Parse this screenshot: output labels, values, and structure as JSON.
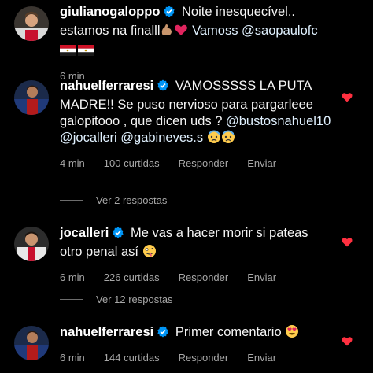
{
  "colors": {
    "background": "#000000",
    "text": "#f5f5f5",
    "meta": "#a8a8a8",
    "verified": "#0095f6",
    "heart": "#ff3040"
  },
  "comments": [
    {
      "username": "giulianogaloppo",
      "verified": true,
      "text": "Noite inesquecível.. estamos na finalll",
      "text_tail": "Vamoss @saopaulofc",
      "emojis": [
        "flexed-biceps-emoji",
        "red-heart-emoji",
        "egypt-flag-emoji",
        "egypt-flag-emoji"
      ],
      "time": "6 min",
      "likes": "",
      "reply": "",
      "send": "",
      "liked": false
    },
    {
      "username": "nahuelferraresi",
      "verified": true,
      "text": "VAMOSSSSS LA PUTA MADRE!! Se puso nervioso para pargarleee galopitooo , que dicen uds ? @bustosnahuel10 @jocalleri @gabineves.s",
      "emojis": [
        "anxious-face-emoji",
        "anxious-face-emoji"
      ],
      "time": "4 min",
      "likes": "100 curtidas",
      "reply": "Responder",
      "send": "Enviar",
      "liked": true
    },
    {
      "username": "jocalleri",
      "verified": true,
      "text": "Me vas a hacer morir si pateas otro penal así",
      "emojis": [
        "zany-face-emoji"
      ],
      "time": "6 min",
      "likes": "226 curtidas",
      "reply": "Responder",
      "send": "Enviar",
      "liked": true
    },
    {
      "username": "nahuelferraresi",
      "verified": true,
      "text": "Primer comentario",
      "emojis": [
        "heart-eyes-emoji"
      ],
      "time": "6 min",
      "likes": "144 curtidas",
      "reply": "Responder",
      "send": "Enviar",
      "liked": true
    }
  ],
  "view_replies": [
    {
      "label": "Ver 2 respostas"
    },
    {
      "label": "Ver 12 respostas"
    }
  ]
}
